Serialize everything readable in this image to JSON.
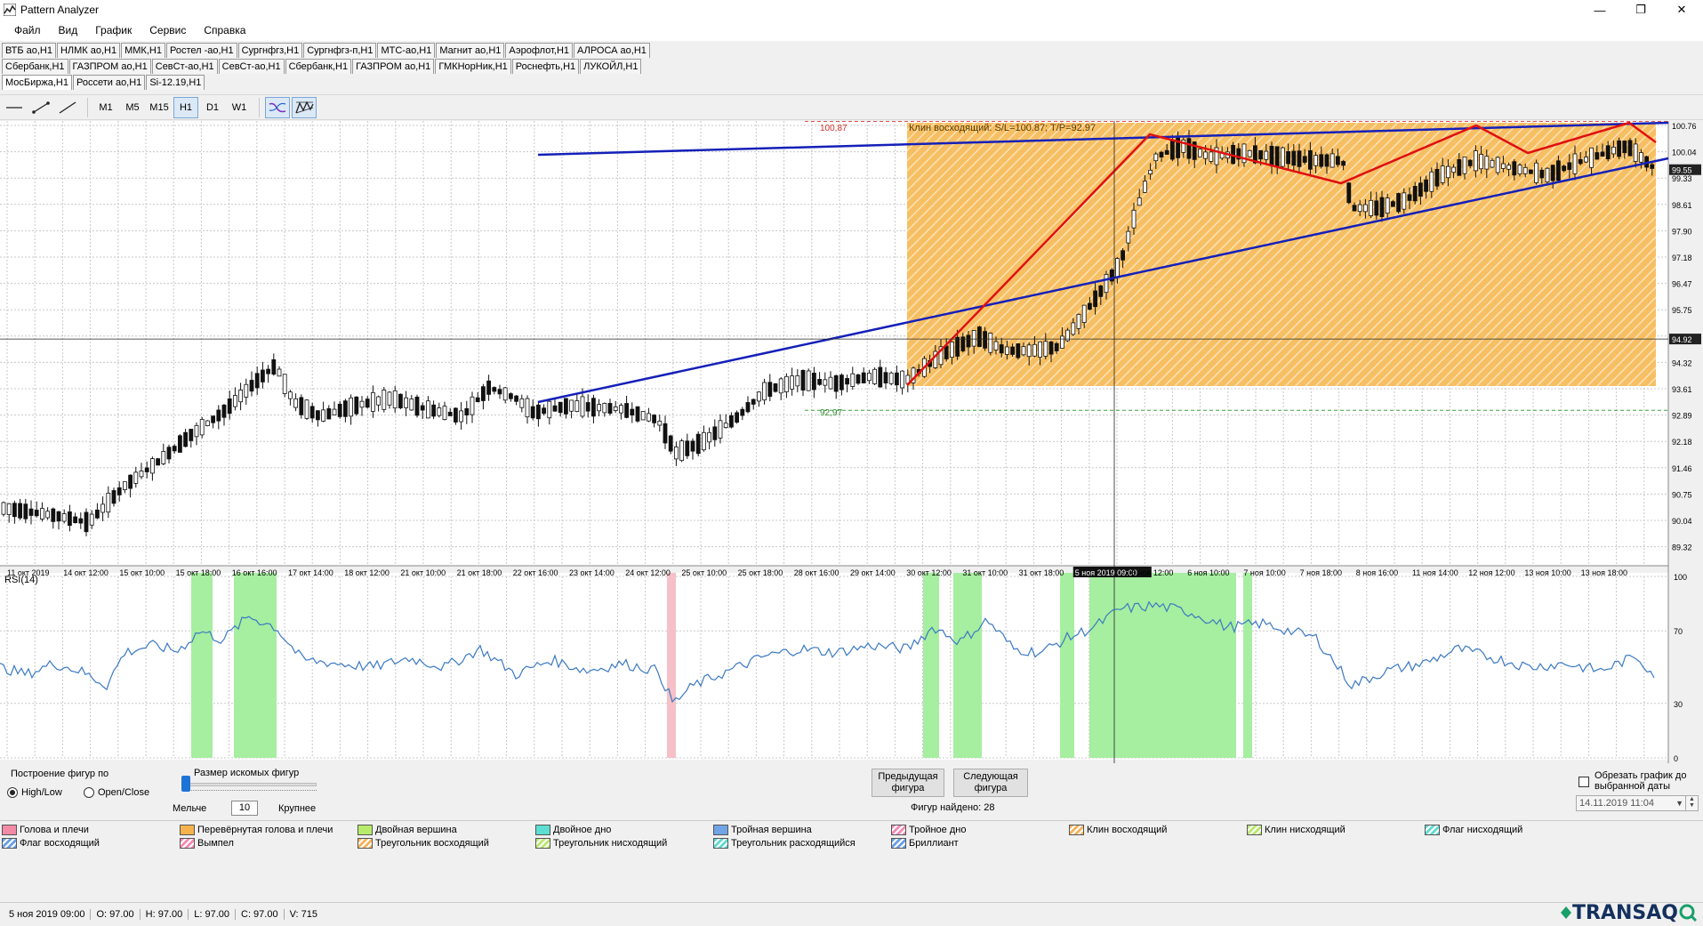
{
  "app": {
    "title": "Pattern Analyzer"
  },
  "menu": [
    "Файл",
    "Вид",
    "График",
    "Сервис",
    "Справка"
  ],
  "window_controls": {
    "minimize": "—",
    "maximize": "❐",
    "close": "✕"
  },
  "instrument_tabs": [
    [
      "ВТБ ао,H1",
      "НЛМК ао,H1",
      "ММК,H1",
      "Ростел -ао,H1",
      "Сургнфгз,H1",
      "Сургнфгз-п,H1",
      "МТС-ао,H1",
      "Магнит ао,H1",
      "Аэрофлот,H1",
      "АЛРОСА ао,H1"
    ],
    [
      "Сбербанк,H1",
      "ГАЗПРОМ ао,H1",
      "СевСт-ао,H1",
      "СевСт-ао,H1",
      "Сбербанк,H1",
      "ГАЗПРОМ ао,H1",
      "ГМКНорНик,H1",
      "Роснефть,H1",
      "ЛУКОЙЛ,H1"
    ],
    [
      "МосБиржа,H1",
      "Россети ао,H1",
      "Si-12.19,H1"
    ]
  ],
  "active_tab": "МосБиржа,H1",
  "toolbar": {
    "draw_tools": [
      "horizontal-line-icon",
      "segment-icon",
      "trend-line-icon"
    ],
    "timeframes": [
      "M1",
      "M5",
      "M15",
      "H1",
      "D1",
      "W1"
    ],
    "selected_timeframe": "H1",
    "indicator_tools": [
      "indicator-icon",
      "pattern-icon"
    ]
  },
  "chart": {
    "y_ticks": [
      "100.76",
      "100.04",
      "99.33",
      "98.61",
      "97.90",
      "97.18",
      "96.47",
      "95.75",
      "95.04",
      "94.32",
      "93.61",
      "92.89",
      "92.18",
      "91.46",
      "90.75",
      "90.04",
      "89.32"
    ],
    "current_price": "99.55",
    "crosshair_price": "94.92",
    "x_labels": [
      "11 окт 2019",
      "14 окт 12:00",
      "15 окт 10:00",
      "15 окт 18:00",
      "16 окт 16:00",
      "17 окт 14:00",
      "18 окт 12:00",
      "21 окт 10:00",
      "21 окт 18:00",
      "22 окт 16:00",
      "23 окт 14:00",
      "24 окт 12:00",
      "25 окт 10:00",
      "25 окт 18:00",
      "28 окт 16:00",
      "29 окт 14:00",
      "30 окт 12:00",
      "31 окт 10:00",
      "31 окт 18:00",
      "5 ноя 2019 09:00",
      "6 ноя 12:00",
      "6 ноя 10:00",
      "7 ноя 10:00",
      "7 ноя 18:00",
      "8 ноя 16:00",
      "11 ноя 14:00",
      "12 ноя 12:00",
      "13 ноя 10:00",
      "13 ноя 18:00"
    ],
    "crosshair_time": "5 ноя 2019 09:00",
    "pattern_label": "Клин восходящий: S/L=100.87; T/P=92.97",
    "stop_loss_label": "100,87",
    "take_profit_label": "92,97",
    "rsi_title": "RSI(14)",
    "rsi_ticks": [
      "100",
      "70",
      "30",
      "0"
    ],
    "colors": {
      "wedge_fill": "#f7bc5c",
      "upper_line": "#1520b8",
      "zigzag": "#e01010",
      "rsi_line": "#3b79c2",
      "rsi_zone_green": "#a6eea0",
      "rsi_zone_pink": "#f6c0c8"
    }
  },
  "controls": {
    "build_by_label": "Построение фигур по",
    "high_low": "High/Low",
    "open_close": "Open/Close",
    "size_label": "Размер искомых фигур",
    "smaller": "Мельче",
    "size_value": "10",
    "larger": "Крупнее",
    "prev_line1": "Предыдущая",
    "prev_line2": "фигура",
    "next_line1": "Следующая",
    "next_line2": "фигура",
    "found": "Фигур найдено: 28",
    "crop_line1": "Обрезать график до",
    "crop_line2": "выбранной даты",
    "crop_checked": false,
    "date_value": "14.11.2019 11:04"
  },
  "legend": [
    {
      "label": "Голова и плечи",
      "color": "#f38aa6",
      "hatch": false
    },
    {
      "label": "Перевёрнутая голова и плечи",
      "color": "#f6b24c",
      "hatch": false
    },
    {
      "label": "Двойная вершина",
      "color": "#b6ec6a",
      "hatch": false
    },
    {
      "label": "Двойное дно",
      "color": "#5cded2",
      "hatch": false
    },
    {
      "label": "Тройная вершина",
      "color": "#6fa4e6",
      "hatch": false
    },
    {
      "label": "Тройное дно",
      "color": "#f28bb2",
      "hatch": true
    },
    {
      "label": "Клин восходящий",
      "color": "#f5b35b",
      "hatch": true
    },
    {
      "label": "Клин нисходящий",
      "color": "#b7e86a",
      "hatch": true
    },
    {
      "label": "Флаг нисходящий",
      "color": "#5fdad2",
      "hatch": true
    },
    {
      "label": "Флаг восходящий",
      "color": "#6a9fe6",
      "hatch": true
    },
    {
      "label": "Вымпел",
      "color": "#f28bb2",
      "hatch": true
    },
    {
      "label": "Треугольник восходящий",
      "color": "#f5b35b",
      "hatch": true
    },
    {
      "label": "Треугольник нисходящий",
      "color": "#b7e86a",
      "hatch": true
    },
    {
      "label": "Треугольник расходящийся",
      "color": "#5fdad2",
      "hatch": true
    },
    {
      "label": "Бриллиант",
      "color": "#6a9fe6",
      "hatch": true
    }
  ],
  "status": {
    "time": "5 ноя 2019 09:00",
    "open": "O: 97.00",
    "high": "H: 97.00",
    "low": "L: 97.00",
    "close": "C: 97.00",
    "volume": "V: 715"
  },
  "brand": "TRANSAQ"
}
